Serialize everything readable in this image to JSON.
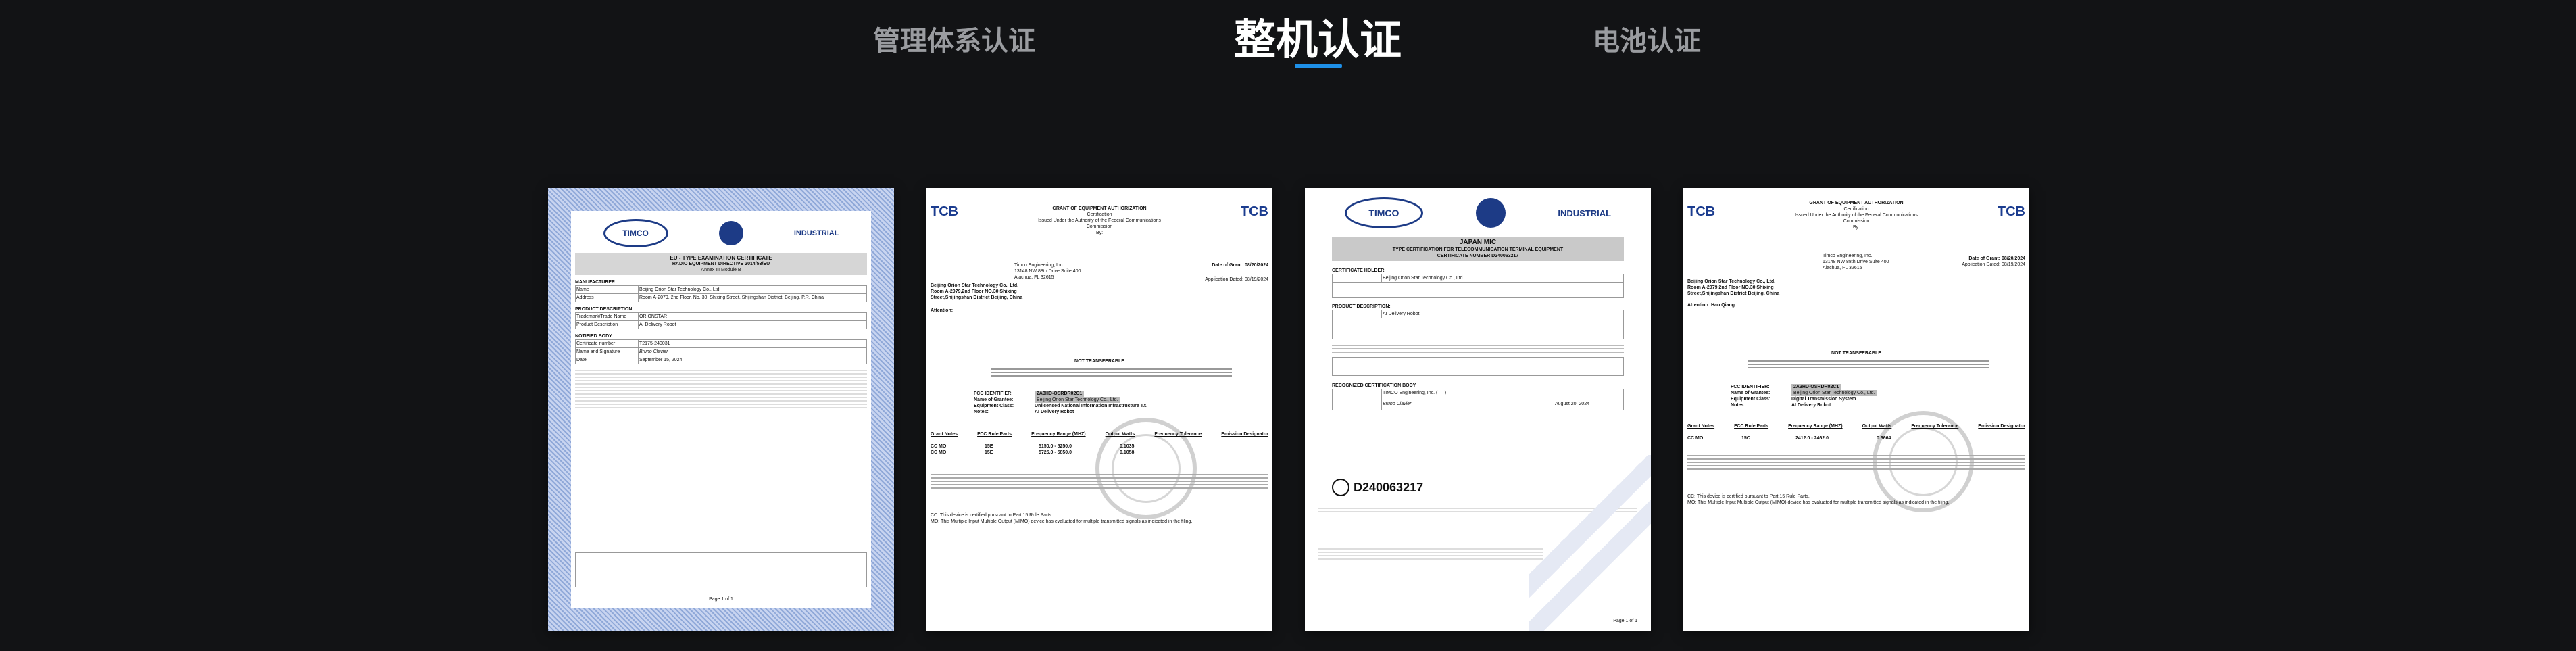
{
  "tabs": [
    {
      "label": "管理体系认证",
      "active": false
    },
    {
      "label": "整机认证",
      "active": true
    },
    {
      "label": "电池认证",
      "active": false
    }
  ],
  "accent_color": "#1e90e8",
  "certificates": [
    {
      "org": "TIMCO",
      "sub": "INDUSTRIAL",
      "title": "EU - TYPE EXAMINATION CERTIFICATE",
      "subtitle": "RADIO EQUIPMENT DIRECTIVE 2014/53/EU",
      "annex": "Annex III Module B",
      "rows": [
        [
          "MANUFACTURER",
          ""
        ],
        [
          "Name",
          "Beijing Orion Star Technology Co., Ltd"
        ],
        [
          "Address",
          "Room A-2079, 2nd Floor, No. 30, Shixing Street, Shijingshan District, Beijing, P.R. China"
        ],
        [
          "PRODUCT DESCRIPTION",
          ""
        ],
        [
          "Trademark/Trade Name",
          "ORIONSTAR"
        ],
        [
          "Product Description",
          "AI Delivery Robot"
        ],
        [
          "NOTIFIED BODY",
          ""
        ],
        [
          "Certificate number",
          "T2175-240031"
        ],
        [
          "Name and Signature",
          "Bruno Clavier"
        ],
        [
          "Date",
          "September 15, 2024"
        ]
      ],
      "page": "Page 1 of 1"
    },
    {
      "tcb": "TCB",
      "grant": "GRANT OF EQUIPMENT AUTHORIZATION",
      "cert": "Certification",
      "issued": "Issued Under the Authority of the Federal Communications Commission",
      "by": "By:",
      "lab": "Timco Engineering, Inc.",
      "lab_addr": "13148 NW 88th Drive Suite 400 Alachua, FL 32615",
      "date_grant": "Date of Grant: 08/20/2024",
      "app_date": "Application Dated: 08/19/2024",
      "company": "Beijing Orion Star Technology Co., Ltd.",
      "address": "Room A-2079,2nd Floor NO.30 Shixing Street,Shijingshan District Beijing, China",
      "attention": "Attention:",
      "not_transferable": "NOT TRANSFERABLE",
      "fcc_label": "FCC IDENTIFIER:",
      "fcc_id": "2A3HD-OSRDR02C1",
      "grantee_label": "Name of Grantee:",
      "grantee": "Beijing Orion Star Technology Co., Ltd.",
      "eq_class_label": "Equipment Class:",
      "eq_class": "Unlicensed National Information Infrastructure TX",
      "notes_label": "Notes:",
      "notes": "AI Delivery Robot",
      "cols": [
        "Grant Notes",
        "FCC Rule Parts",
        "Frequency Range (MHZ)",
        "Output Watts",
        "Frequency Tolerance",
        "Emission Designator"
      ],
      "r1": [
        "CC MO",
        "15E",
        "5150.0 - 5250.0",
        "0.1035"
      ],
      "r2": [
        "CC MO",
        "15E",
        "5725.0 - 5850.0",
        "0.1058"
      ],
      "cc": "CC: This device is certified pursuant to Part 15 Rule Parts.",
      "mo": "MO: This Multiple Input Multiple Output (MIMO) device has evaluated for multiple transmitted signals as indicated in the filing."
    },
    {
      "org": "TIMCO",
      "sub": "INDUSTRIAL",
      "title": "JAPAN MIC",
      "subtitle": "TYPE CERTIFICATION FOR TELECOMMUNICATION TERMINAL EQUIPMENT",
      "number": "CERTIFICATE NUMBER D240063217",
      "holder": "CERTIFICATE HOLDER:",
      "company": "Beijing Orion Star Technology Co., Ltd",
      "product": "PRODUCT DESCRIPTION:",
      "product_name": "AI Delivery Robot",
      "body": "RECOGNIZED CERTIFICATION BODY",
      "body_name": "TIMCO Engineering, Inc. (TIT)",
      "sign": "Bruno Clavier",
      "date": "August 20, 2024",
      "mark": "D240063217",
      "page": "Page 1 of 1"
    },
    {
      "tcb": "TCB",
      "grant": "GRANT OF EQUIPMENT AUTHORIZATION",
      "cert": "Certification",
      "issued": "Issued Under the Authority of the Federal Communications Commission",
      "by": "By:",
      "lab": "Timco Engineering, Inc.",
      "lab_addr": "13148 NW 88th Drive Suite 400 Alachua, FL 32615",
      "date_grant": "Date of Grant: 08/20/2024",
      "app_date": "Application Dated: 08/19/2024",
      "company": "Beijing Orion Star Technology Co., Ltd.",
      "address": "Room A-2079,2nd Floor NO.30 Shixing Street,Shijingshan District Beijing, China",
      "attention": "Attention: Hao Qiang",
      "not_transferable": "NOT TRANSFERABLE",
      "fcc_label": "FCC IDENTIFIER:",
      "fcc_id": "2A3HD-OSRDR02C1",
      "grantee_label": "Name of Grantee:",
      "grantee": "Beijing Orion Star Technology Co., Ltd.",
      "eq_class_label": "Equipment Class:",
      "eq_class": "Digital Transmission System",
      "notes_label": "Notes:",
      "notes": "AI Delivery Robot",
      "cols": [
        "Grant Notes",
        "FCC Rule Parts",
        "Frequency Range (MHZ)",
        "Output Watts",
        "Frequency Tolerance",
        "Emission Designator"
      ],
      "r1": [
        "CC MO",
        "15C",
        "2412.0 - 2462.0",
        "0.3664"
      ],
      "cc": "CC: This device is certified pursuant to Part 15 Rule Parts.",
      "mo": "MO: This Multiple Input Multiple Output (MIMO) device has evaluated for multiple transmitted signals as indicated in the filing."
    }
  ]
}
